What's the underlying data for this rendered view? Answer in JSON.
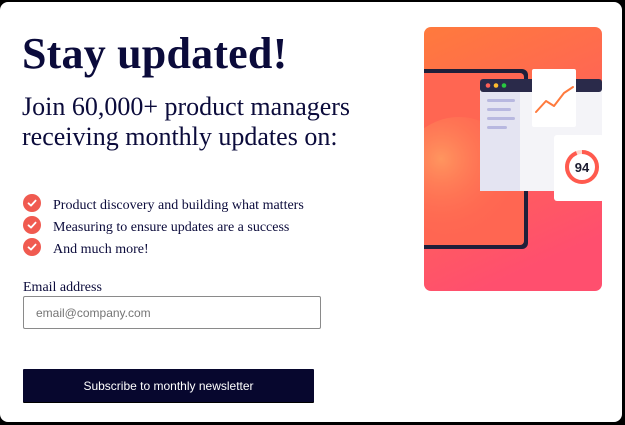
{
  "heading": "Stay updated!",
  "subheading": "Join 60,000+ product managers receiving monthly updates on:",
  "benefits": [
    {
      "text": "Product discovery and building what matters"
    },
    {
      "text": "Measuring to ensure updates are a success"
    },
    {
      "text": "And much more!"
    }
  ],
  "form": {
    "email_label": "Email address",
    "email_placeholder": "email@company.com",
    "email_value": "",
    "submit_label": "Subscribe to monthly newsletter"
  },
  "illustration": {
    "score": "94",
    "icon": "dashboard-illustration"
  },
  "colors": {
    "primary": "#07072e",
    "accent": "#f05a50",
    "gradient_top": "#ff7a3d",
    "gradient_bottom": "#ff4f6e"
  }
}
